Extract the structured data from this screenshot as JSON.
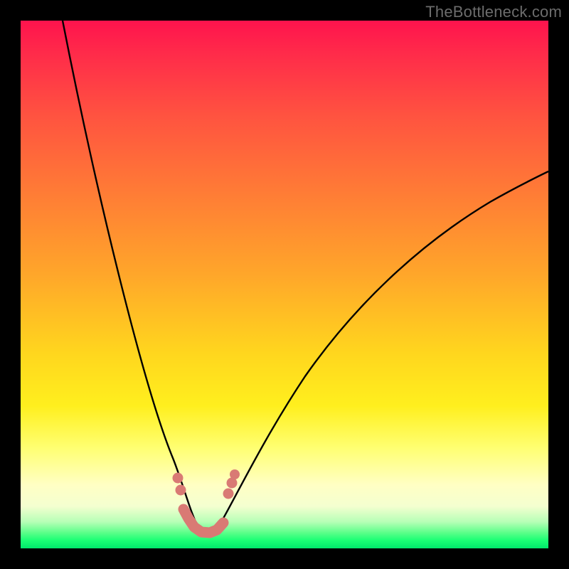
{
  "watermark": "TheBottleneck.com",
  "colors": {
    "frame": "#000000",
    "curve": "#000000",
    "marker_fill": "#d97a74",
    "marker_stroke": "#c96a64",
    "gradient_top": "#ff134d",
    "gradient_bottom": "#00e86b"
  },
  "chart_data": {
    "type": "line",
    "title": "",
    "xlabel": "",
    "ylabel": "",
    "xlim": [
      0,
      100
    ],
    "ylim": [
      0,
      100
    ],
    "legend": false,
    "series": [
      {
        "name": "bottleneck-curve",
        "comment": "V-shaped curve; y≈0 at the minimum and rises steeply to both sides. Values estimated from pixel positions (no axis labels present).",
        "x": [
          8,
          12,
          16,
          20,
          24,
          26,
          28,
          29.5,
          31,
          32.5,
          34,
          35,
          37,
          38,
          39,
          42,
          46,
          52,
          60,
          70,
          80,
          90,
          100
        ],
        "y": [
          100,
          82,
          64,
          48,
          33,
          26,
          19,
          14,
          10,
          7,
          4.5,
          3,
          3,
          5,
          8,
          13,
          20,
          30,
          42,
          55,
          64,
          71,
          76
        ]
      }
    ],
    "markers": {
      "name": "highlighted-points",
      "comment": "Pink rounded markers clustered near the curve minimum.",
      "points": [
        {
          "x": 29.5,
          "y": 14
        },
        {
          "x": 30.2,
          "y": 11.5
        },
        {
          "x": 31.2,
          "y": 7.5
        },
        {
          "x": 32.0,
          "y": 5.5
        },
        {
          "x": 33.0,
          "y": 3.8
        },
        {
          "x": 34.2,
          "y": 3.2
        },
        {
          "x": 35.2,
          "y": 3.0
        },
        {
          "x": 37.0,
          "y": 3.4
        },
        {
          "x": 38.2,
          "y": 6.5
        },
        {
          "x": 39.2,
          "y": 9.0
        },
        {
          "x": 40.2,
          "y": 11.8
        },
        {
          "x": 40.8,
          "y": 13.0
        }
      ]
    }
  }
}
